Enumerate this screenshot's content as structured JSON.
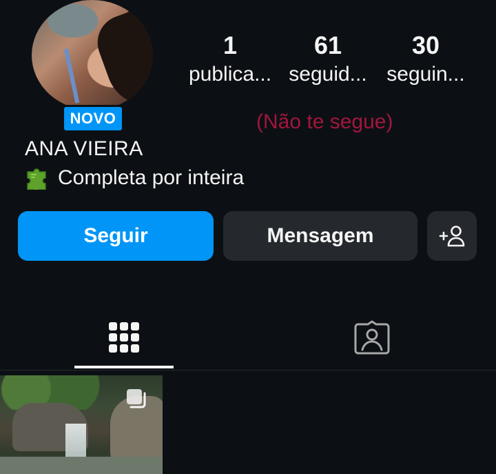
{
  "profile": {
    "badge": "NOVO",
    "name": "ANA VIEIRA",
    "bio_emoji": "puzzle-piece",
    "bio_text": "Completa por inteira",
    "relationship_note": "(Não te segue)"
  },
  "stats": [
    {
      "count": "1",
      "label": "publica..."
    },
    {
      "count": "61",
      "label": "seguid..."
    },
    {
      "count": "30",
      "label": "seguin..."
    }
  ],
  "actions": {
    "follow": "Seguir",
    "message": "Mensagem",
    "add_icon": "add-person-icon"
  },
  "tabs": [
    {
      "icon": "grid-icon",
      "active": true
    },
    {
      "icon": "tagged-photos-icon",
      "active": false
    }
  ],
  "colors": {
    "background": "#0c1014",
    "accent_blue": "#0095f6",
    "secondary_button": "#25292e",
    "not_following_red": "#a4153d"
  }
}
